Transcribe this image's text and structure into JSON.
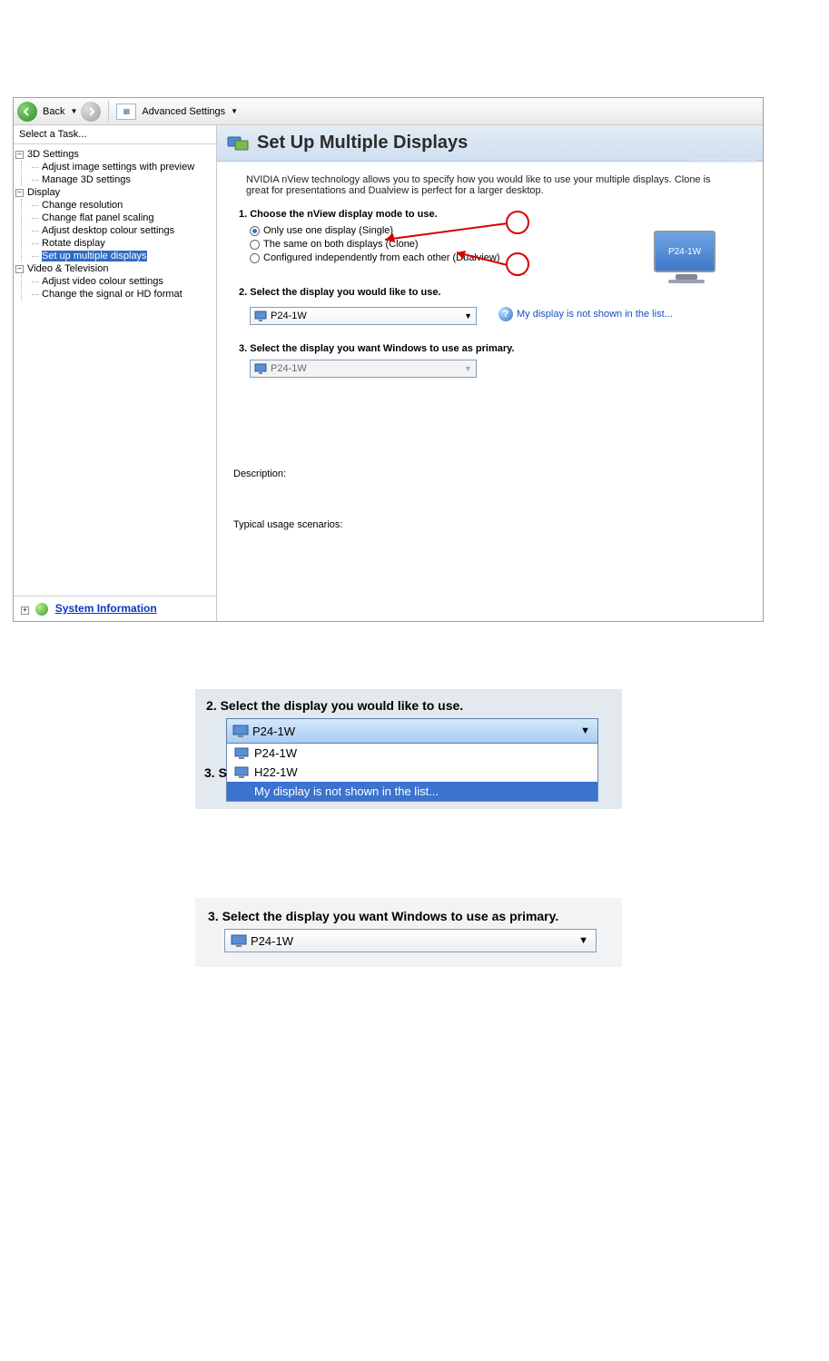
{
  "toolbar": {
    "back": "Back",
    "advanced": "Advanced Settings"
  },
  "sidebar": {
    "task_header": "Select a Task...",
    "groups": [
      {
        "label": "3D Settings",
        "items": [
          "Adjust image settings with preview",
          "Manage 3D settings"
        ]
      },
      {
        "label": "Display",
        "items": [
          "Change resolution",
          "Change flat panel scaling",
          "Adjust desktop colour settings",
          "Rotate display",
          "Set up multiple displays"
        ],
        "selected_index": 4
      },
      {
        "label": "Video & Television",
        "items": [
          "Adjust video colour settings",
          "Change the signal or HD format"
        ]
      }
    ],
    "sysinfo": "System Information"
  },
  "main": {
    "title": "Set Up Multiple Displays",
    "restore": "Restore Defaults",
    "intro": "NVIDIA nView technology allows you to specify how you would like to use your multiple displays. Clone is great for presentations and Dualview is perfect for a larger desktop.",
    "step1": {
      "title": "1. Choose the nView display mode to use.",
      "options": [
        "Only use one display (Single)",
        "The same on both displays (Clone)",
        "Configured independently from each other (Dualview)"
      ],
      "selected": 0
    },
    "step2": {
      "title": "2. Select the display you would like to use.",
      "value": "P24-1W",
      "help": "My display is not shown in the list..."
    },
    "step3": {
      "title": "3. Select the display you want Windows to use as primary.",
      "value": "P24-1W"
    },
    "monitor_label": "P24-1W",
    "description_label": "Description:",
    "typical_label": "Typical usage scenarios:"
  },
  "panel2": {
    "title": "2. Select the display you would like to use.",
    "selected": "P24-1W",
    "options": [
      "P24-1W",
      "H22-1W",
      "My display is not shown in the list..."
    ],
    "highlighted_index": 2,
    "step3_prefix": "3. S"
  },
  "panel3": {
    "title": "3. Select the display you want Windows to use as primary.",
    "value": "P24-1W"
  }
}
